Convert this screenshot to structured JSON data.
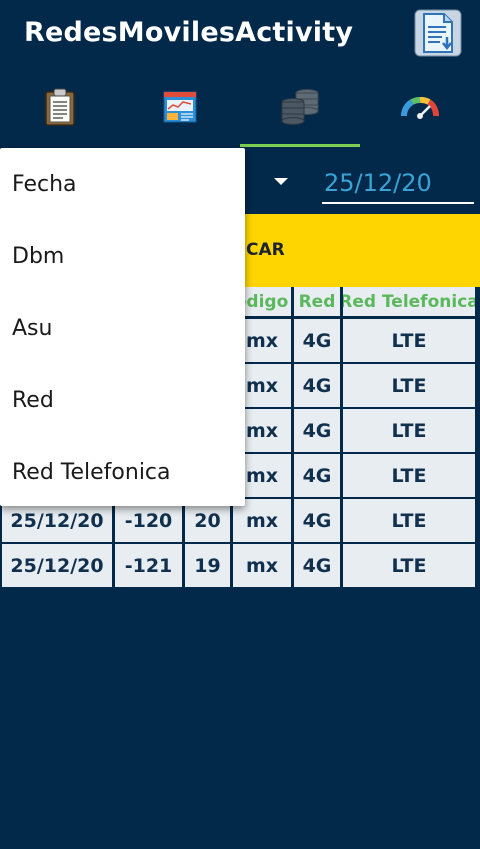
{
  "app": {
    "title": "RedesMovilesActivity"
  },
  "toolbar": {
    "action_icon": "document-download-icon"
  },
  "tabs": [
    {
      "icon": "clipboard-icon"
    },
    {
      "icon": "report-chart-icon"
    },
    {
      "icon": "database-icon",
      "selected": true
    },
    {
      "icon": "speedometer-icon"
    }
  ],
  "filter": {
    "date_value": "25/12/20"
  },
  "search_button": {
    "label_visible": "CAR"
  },
  "table": {
    "headers_visible": [
      "odigo",
      "Red",
      "Red Telefonica"
    ],
    "rows": [
      {
        "fecha": "",
        "dbm": "",
        "asu": "",
        "codigo": "mx",
        "red": "4G",
        "red_telefonica": "LTE"
      },
      {
        "fecha": "",
        "dbm": "",
        "asu": "",
        "codigo": "mx",
        "red": "4G",
        "red_telefonica": "LTE"
      },
      {
        "fecha": "",
        "dbm": "",
        "asu": "",
        "codigo": "mx",
        "red": "4G",
        "red_telefonica": "LTE"
      },
      {
        "fecha": "",
        "dbm": "",
        "asu": "",
        "codigo": "mx",
        "red": "4G",
        "red_telefonica": "LTE"
      },
      {
        "fecha": "25/12/20",
        "dbm": "-120",
        "asu": "20",
        "codigo": "mx",
        "red": "4G",
        "red_telefonica": "LTE"
      },
      {
        "fecha": "25/12/20",
        "dbm": "-121",
        "asu": "19",
        "codigo": "mx",
        "red": "4G",
        "red_telefonica": "LTE"
      }
    ]
  },
  "dropdown": {
    "items": [
      "Fecha",
      "Dbm",
      "Asu",
      "Red",
      "Red Telefonica"
    ]
  },
  "colors": {
    "background": "#02284a",
    "accent": "#7ccf50",
    "button": "#ffd500",
    "header_text": "#5cb85c",
    "date_text": "#3aa3d6"
  }
}
